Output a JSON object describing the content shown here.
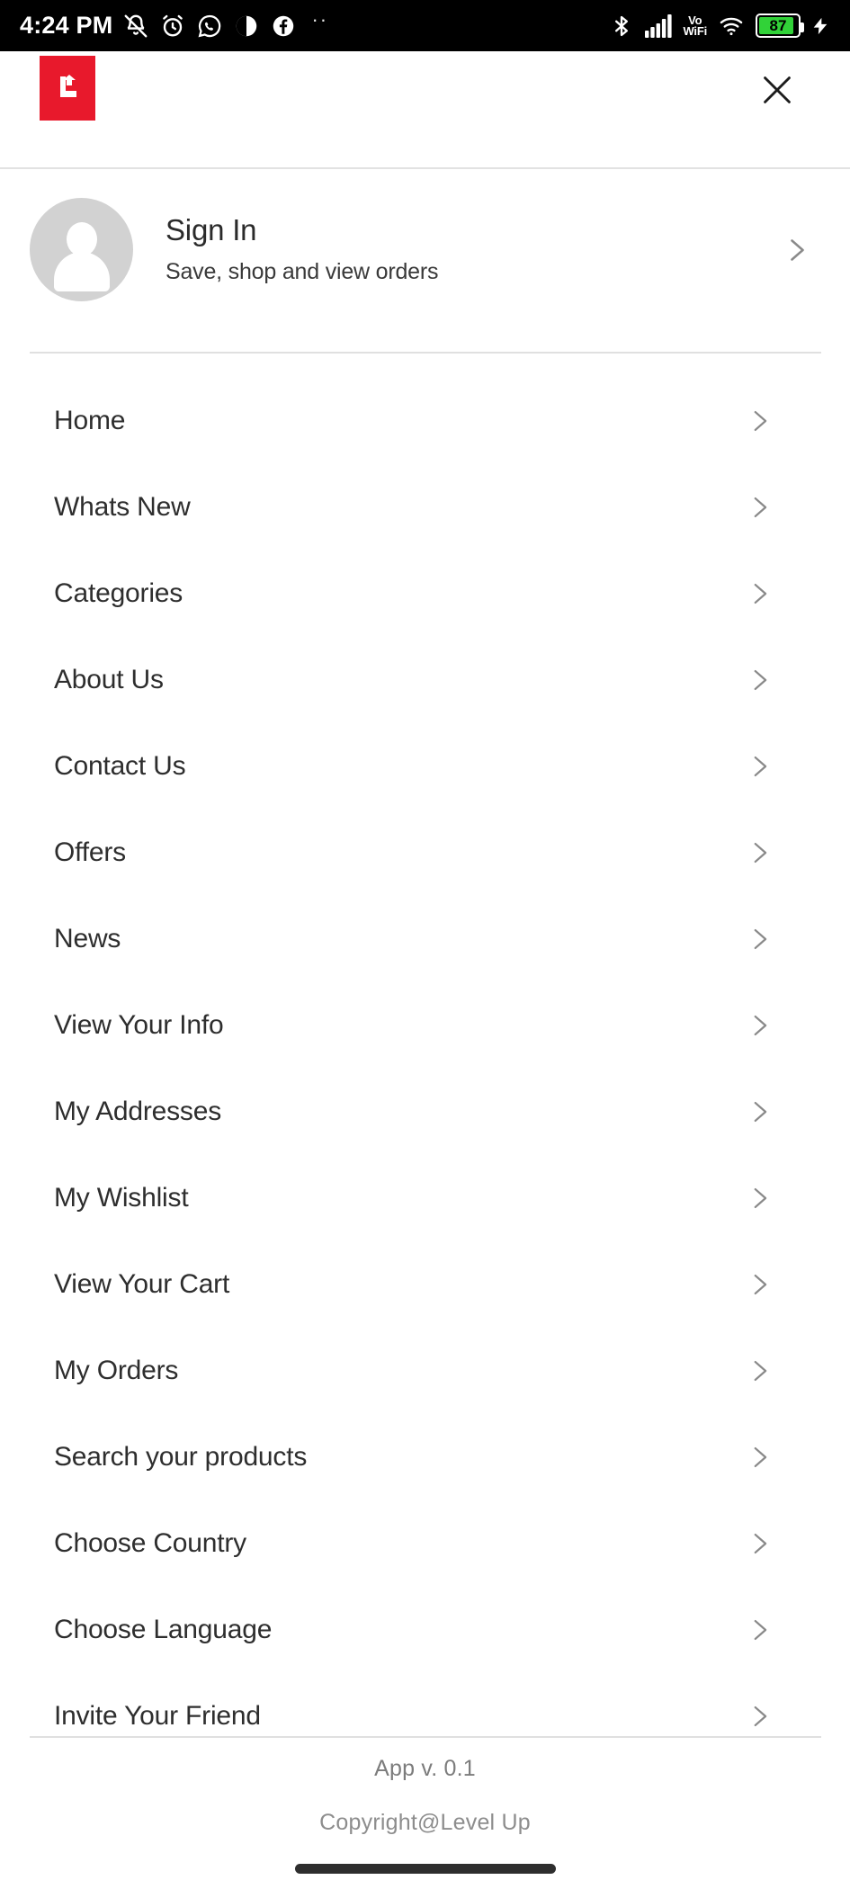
{
  "status_bar": {
    "time": "4:24 PM",
    "left_icons": [
      "bell-off-icon",
      "alarm-clock-icon",
      "whatsapp-icon",
      "circle-app-icon",
      "facebook-icon"
    ],
    "overflow_dots": "··",
    "right_icons": [
      "bluetooth-icon",
      "cellular-signal-icon",
      "wifi-icon",
      "charging-bolt-icon"
    ],
    "vowifi_line1": "Vo",
    "vowifi_line2": "WiFi",
    "battery_percent": "87",
    "battery_color": "#31d238",
    "background": "#000000",
    "foreground": "#ffffff"
  },
  "header": {
    "logo_name": "level-up-logo",
    "logo_color": "#e8192c",
    "close_label": "×"
  },
  "profile": {
    "title": "Sign In",
    "subtitle": "Save, shop and view orders"
  },
  "menu": {
    "items": [
      {
        "label": "Home"
      },
      {
        "label": "Whats New"
      },
      {
        "label": "Categories"
      },
      {
        "label": "About Us"
      },
      {
        "label": "Contact Us"
      },
      {
        "label": "Offers"
      },
      {
        "label": "News"
      },
      {
        "label": "View Your Info"
      },
      {
        "label": "My Addresses"
      },
      {
        "label": "My Wishlist"
      },
      {
        "label": "View Your Cart"
      },
      {
        "label": "My Orders"
      },
      {
        "label": "Search your products"
      },
      {
        "label": "Choose Country"
      },
      {
        "label": "Choose Language"
      },
      {
        "label": "Invite Your Friend"
      }
    ]
  },
  "footer": {
    "app_version": "App v. 0.1",
    "copyright": "Copyright@Level Up"
  },
  "colors": {
    "accent": "#e8192c",
    "text": "#2e2e2e",
    "muted": "#8d8d8d",
    "divider": "#e0e0e0"
  }
}
